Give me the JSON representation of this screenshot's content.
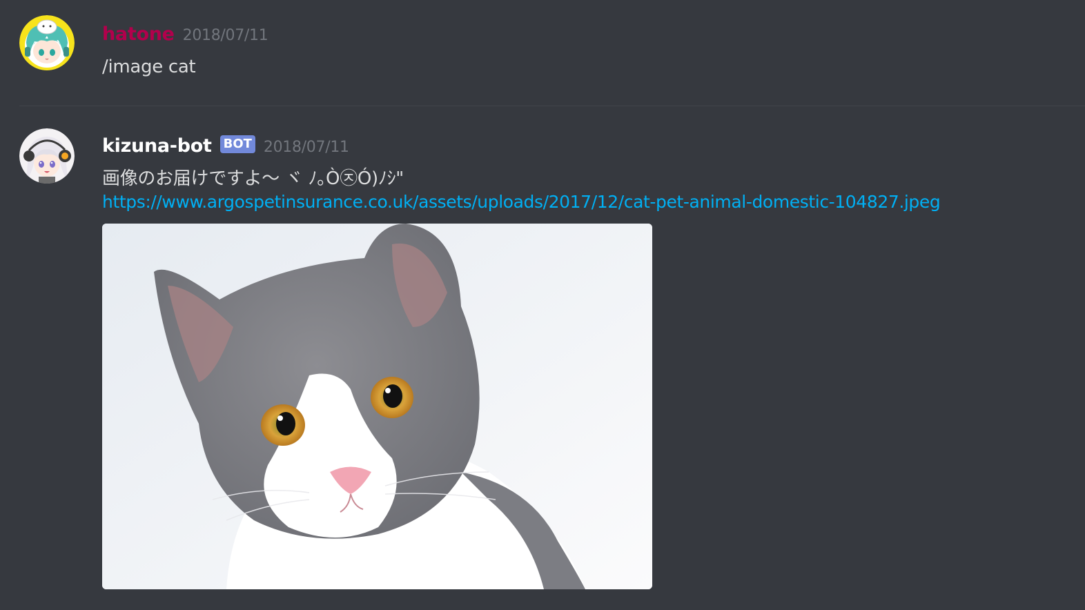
{
  "messages": [
    {
      "username": "hatone",
      "username_color": "#b3004c",
      "timestamp": "2018/07/11",
      "content": "/image cat",
      "avatar_icon": "anime-girl-avatar-yellow-ring"
    },
    {
      "username": "kizuna-bot",
      "username_color": "#ffffff",
      "bot_tag": "BOT",
      "timestamp": "2018/07/11",
      "text": "画像のお届けですよ〜 ヾ ﾉ｡Ò㉨Ó)ﾉｼ\"",
      "link": "https://www.argospetinsurance.co.uk/assets/uploads/2017/12/cat-pet-animal-domestic-104827.jpeg",
      "avatar_icon": "anime-girl-avatar-headphones",
      "embed_image": "cat-photo"
    }
  ],
  "colors": {
    "background": "#36393f",
    "link": "#00b0f4",
    "bot_tag": "#7289da",
    "timestamp": "#72767d",
    "text": "#dcddde"
  }
}
